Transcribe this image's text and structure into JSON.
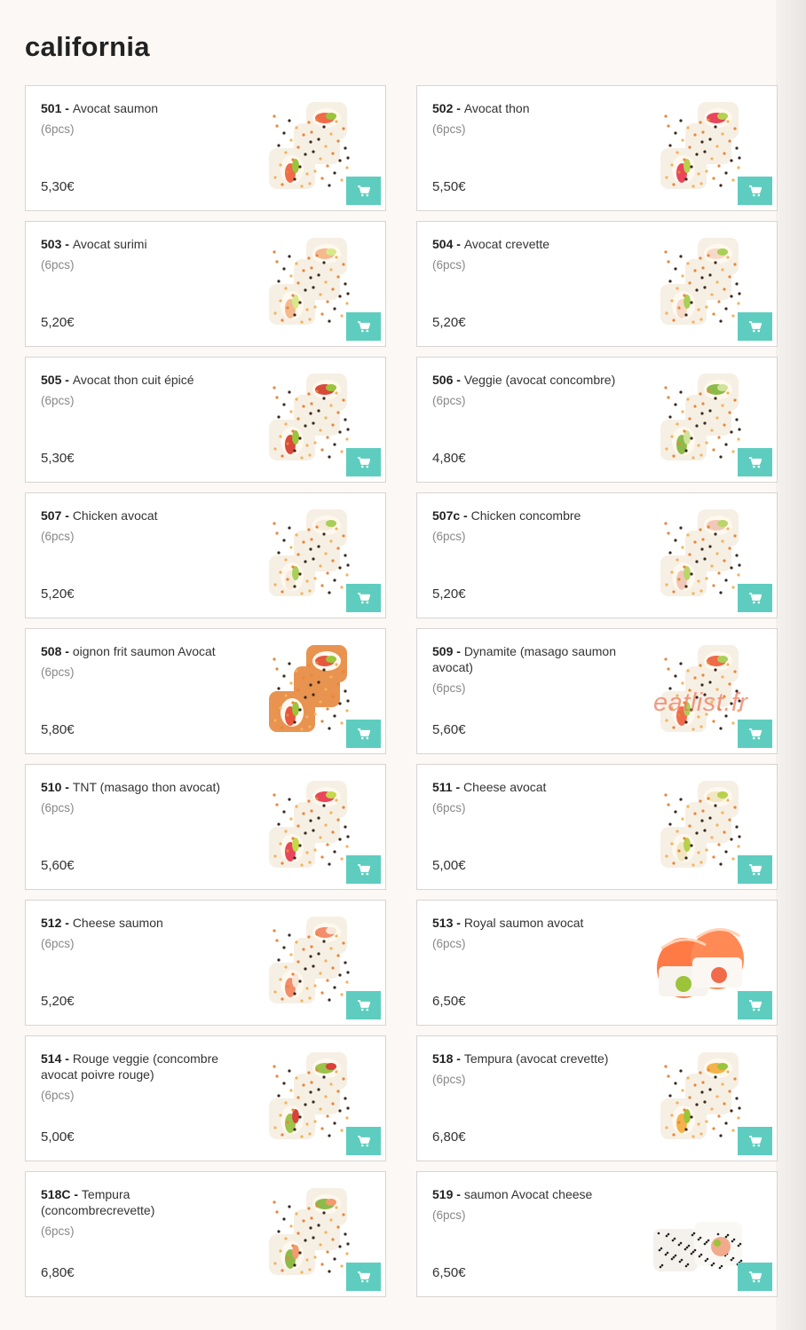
{
  "page": {
    "title": "california"
  },
  "products": [
    {
      "code": "501",
      "name": "Avocat saumon",
      "qty": "(6pcs)",
      "price": "5,30€",
      "image": "california-roll-salmon-avocado",
      "style": "classic"
    },
    {
      "code": "502",
      "name": "Avocat thon",
      "qty": "(6pcs)",
      "price": "5,50€",
      "image": "california-roll-tuna-avocado",
      "style": "classic"
    },
    {
      "code": "503",
      "name": "Avocat surimi",
      "qty": "(6pcs)",
      "price": "5,20€",
      "image": "california-roll-surimi-avocado",
      "style": "classic"
    },
    {
      "code": "504",
      "name": "Avocat crevette",
      "qty": "(6pcs)",
      "price": "5,20€",
      "image": "california-roll-shrimp-avocado",
      "style": "classic"
    },
    {
      "code": "505",
      "name": "Avocat thon cuit épicé",
      "qty": "(6pcs)",
      "price": "5,30€",
      "image": "california-roll-spicy-tuna",
      "style": "classic"
    },
    {
      "code": "506",
      "name": "Veggie (avocat concombre)",
      "qty": "(6pcs)",
      "price": "4,80€",
      "image": "california-roll-veggie",
      "style": "classic"
    },
    {
      "code": "507",
      "name": "Chicken avocat",
      "qty": "(6pcs)",
      "price": "5,20€",
      "image": "california-roll-chicken-avocado",
      "style": "classic"
    },
    {
      "code": "507c",
      "name": "Chicken concombre",
      "qty": "(6pcs)",
      "price": "5,20€",
      "image": "california-roll-chicken-cucumber",
      "style": "classic"
    },
    {
      "code": "508",
      "name": "oignon frit saumon Avocat",
      "qty": "(6pcs)",
      "price": "5,80€",
      "image": "california-roll-fried-onion",
      "style": "crispy"
    },
    {
      "code": "509",
      "name": "Dynamite (masago saumon avocat)",
      "qty": "(6pcs)",
      "price": "5,60€",
      "image": "california-roll-dynamite",
      "style": "classic",
      "watermark": "eatlist.fr"
    },
    {
      "code": "510",
      "name": "TNT (masago thon avocat)",
      "qty": "(6pcs)",
      "price": "5,60€",
      "image": "california-roll-tnt",
      "style": "classic"
    },
    {
      "code": "511",
      "name": "Cheese avocat",
      "qty": "(6pcs)",
      "price": "5,00€",
      "image": "california-roll-cheese-avocado",
      "style": "classic"
    },
    {
      "code": "512",
      "name": "Cheese saumon",
      "qty": "(6pcs)",
      "price": "5,20€",
      "image": "california-roll-cheese-salmon",
      "style": "classic"
    },
    {
      "code": "513",
      "name": "Royal saumon avocat",
      "qty": "(6pcs)",
      "price": "6,50€",
      "image": "salmon-wrapped-roll",
      "style": "salmon"
    },
    {
      "code": "514",
      "name": "Rouge veggie (concombre avocat poivre rouge)",
      "qty": "(6pcs)",
      "price": "5,00€",
      "image": "california-roll-red-veggie",
      "style": "classic"
    },
    {
      "code": "518",
      "name": "Tempura (avocat crevette)",
      "qty": "(6pcs)",
      "price": "6,80€",
      "image": "california-roll-tempura",
      "style": "classic"
    },
    {
      "code": "518C",
      "name": "Tempura (concombrecrevette)",
      "qty": "(6pcs)",
      "price": "6,80€",
      "image": "california-roll-tempura-cucumber",
      "style": "classic"
    },
    {
      "code": "519",
      "name": "saumon Avocat cheese",
      "qty": "(6pcs)",
      "price": "6,50€",
      "image": "sesame-roll-salmon-cheese",
      "style": "sesame"
    }
  ],
  "icons": {
    "cart": "shopping-cart-icon"
  },
  "colors": {
    "accent": "#5ecdbf",
    "background": "#fbf8f6",
    "card_border": "#d9d4d1"
  }
}
